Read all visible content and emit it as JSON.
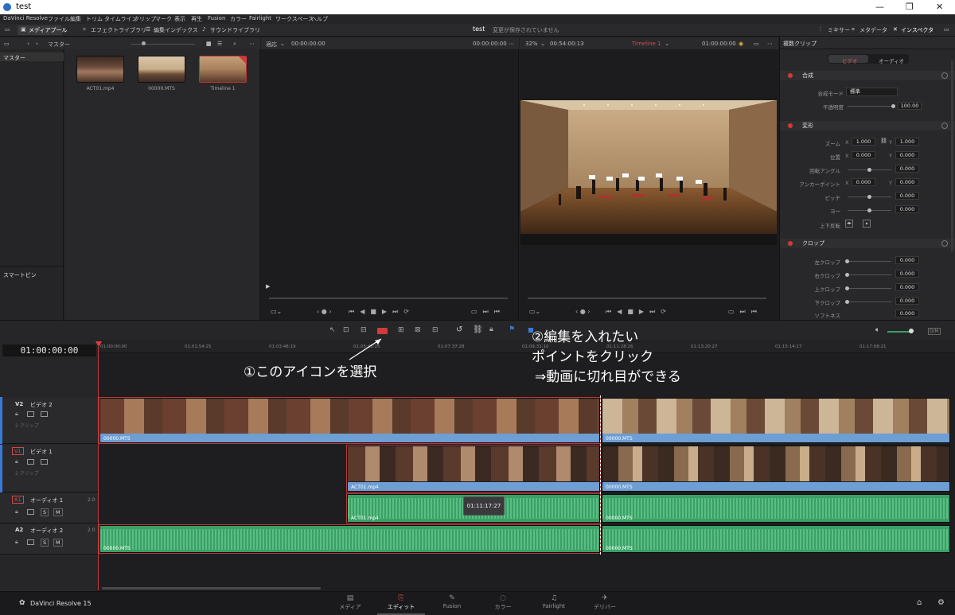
{
  "window": {
    "title": "test"
  },
  "menu": [
    "DaVinci Resolve",
    "ファイル",
    "編集",
    "トリム",
    "タイムライン",
    "クリップ",
    "マーク",
    "表示",
    "再生",
    "Fusion",
    "カラー",
    "Fairlight",
    "ワークスペース",
    "ヘルプ"
  ],
  "toolbar": {
    "media_pool": "メディアプール",
    "effects_library": "エフェクトライブラリ",
    "edit_index": "編集インデックス",
    "sound_library": "サウンドライブラリ",
    "project_name": "test",
    "unsaved_status": "変更が保存されていません",
    "mixer": "ミキサー",
    "metadata": "メタデータ",
    "inspector": "インスペクタ"
  },
  "media_pool": {
    "bin_header": "マスター",
    "bins": [
      "マスター"
    ],
    "smart_bins": "スマートビン",
    "clips": [
      {
        "name": "ACT01.mp4"
      },
      {
        "name": "00000.MTS"
      },
      {
        "name": "Timeline 1"
      }
    ]
  },
  "source_viewer": {
    "fit": "適応",
    "timecode": "00:00:00:00",
    "tc_right": "00:00:00:00"
  },
  "timeline_viewer": {
    "zoom": "32%",
    "duration": "00:54:00:13",
    "timeline_name": "Timeline 1",
    "timecode": "01:00:00:00"
  },
  "inspector": {
    "title": "複数クリップ",
    "tabs": [
      "ビデオ",
      "オーディオ"
    ],
    "sections": {
      "composite": {
        "label": "合成",
        "mode_label": "合成モード",
        "mode_value": "標準",
        "opacity_label": "不透明度",
        "opacity_value": "100.00"
      },
      "transform": {
        "label": "変形",
        "zoom_label": "ズーム",
        "zoom_x": "1.000",
        "zoom_y": "1.000",
        "pos_label": "位置",
        "pos_x": "0.000",
        "pos_y": "0.000",
        "rot_label": "回転アングル",
        "rot_value": "0.000",
        "anchor_label": "アンカーポイント",
        "anchor_x": "0.000",
        "anchor_y": "0.000",
        "pitch_label": "ピッチ",
        "pitch_value": "0.000",
        "yaw_label": "ヨー",
        "yaw_value": "0.000",
        "flip_label": "上下反転"
      },
      "crop": {
        "label": "クロップ",
        "left_label": "左クロップ",
        "left": "0.000",
        "right_label": "右クロップ",
        "right": "0.000",
        "top_label": "上クロップ",
        "top": "0.000",
        "bottom_label": "下クロップ",
        "bottom": "0.000",
        "soft_label": "ソフトネス",
        "soft": "0.000"
      }
    }
  },
  "timeline": {
    "timecode": "01:00:00:00",
    "ruler": [
      "01:00:00:00",
      "01:01:54:25",
      "01:03:48:19",
      "01:05:42:25",
      "01:07:37:28",
      "01:09:31:10",
      "01:11:28:26",
      "01:13:20:27",
      "01:15:14:17",
      "01:17:08:21"
    ],
    "tracks": [
      {
        "id": "V2",
        "name": "ビデオ 2",
        "count": "2 クリップ"
      },
      {
        "id": "V1",
        "name": "ビデオ 1",
        "count": "2 クリップ"
      },
      {
        "id": "A1",
        "name": "オーディオ 1",
        "ch": "2.0"
      },
      {
        "id": "A2",
        "name": "オーディオ 2",
        "ch": "2.0"
      }
    ],
    "clips": {
      "v2a": "00000.MTS",
      "v2b": "00000.MTS",
      "v1a": "ACT01.mp4",
      "v1b": "00000.MTS",
      "a1a": "ACT01.mp4",
      "a1b": "00000.MTS",
      "a2a": "00000.MTS",
      "a2b": "00000.MTS"
    },
    "tooltip": "01:11:17:27"
  },
  "annotations": {
    "step1": "①このアイコンを選択",
    "step2_line1": "②編集を入れたい",
    "step2_line2": "ポイントをクリック",
    "step2_line3": "⇒動画に切れ目ができる"
  },
  "pages": {
    "brand": "DaVinci Resolve 15",
    "tabs": [
      "メディア",
      "エディット",
      "Fusion",
      "カラー",
      "Fairlight",
      "デリバー"
    ],
    "active": "エディット"
  },
  "colors": {
    "accent_red": "#c0393b",
    "video_bar": "#6d9ed4",
    "audio_clip": "#3aa065"
  }
}
